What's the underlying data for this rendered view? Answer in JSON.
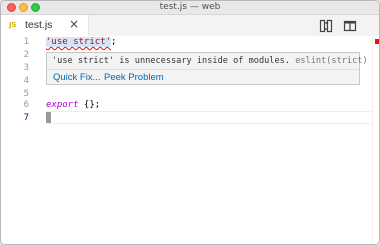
{
  "window": {
    "title": "test.js — web"
  },
  "tab": {
    "icon_text": "JS",
    "label": "test.js",
    "close_glyph": "×",
    "icon_color": "#cbb20d"
  },
  "editor": {
    "lines": [
      {
        "number": "1",
        "text": "'use strict';"
      },
      {
        "number": "2",
        "text": ""
      },
      {
        "number": "3",
        "text": ""
      },
      {
        "number": "4",
        "text": ""
      },
      {
        "number": "5",
        "text": ""
      },
      {
        "number": "6",
        "text": "export {};"
      },
      {
        "number": "7",
        "text": ""
      }
    ],
    "active_line": "7",
    "tokens": {
      "line1_string": "'use strict'",
      "line1_semicolon": ";",
      "line6_keyword": "export",
      "line6_rest": " {};"
    }
  },
  "hover": {
    "message": "'use strict' is unnecessary inside of modules.",
    "source": "eslint(strict)",
    "actions": {
      "quick_fix": "Quick Fix...",
      "peek_problem": "Peek Problem"
    }
  },
  "colors": {
    "error": "#e51400",
    "link": "#006ab1",
    "keyword": "#af00db",
    "string": "#a31515"
  },
  "icons": {
    "compare": "compare-changes-icon",
    "split": "split-editor-icon",
    "close": "close-icon",
    "js_file": "javascript-file-icon"
  }
}
